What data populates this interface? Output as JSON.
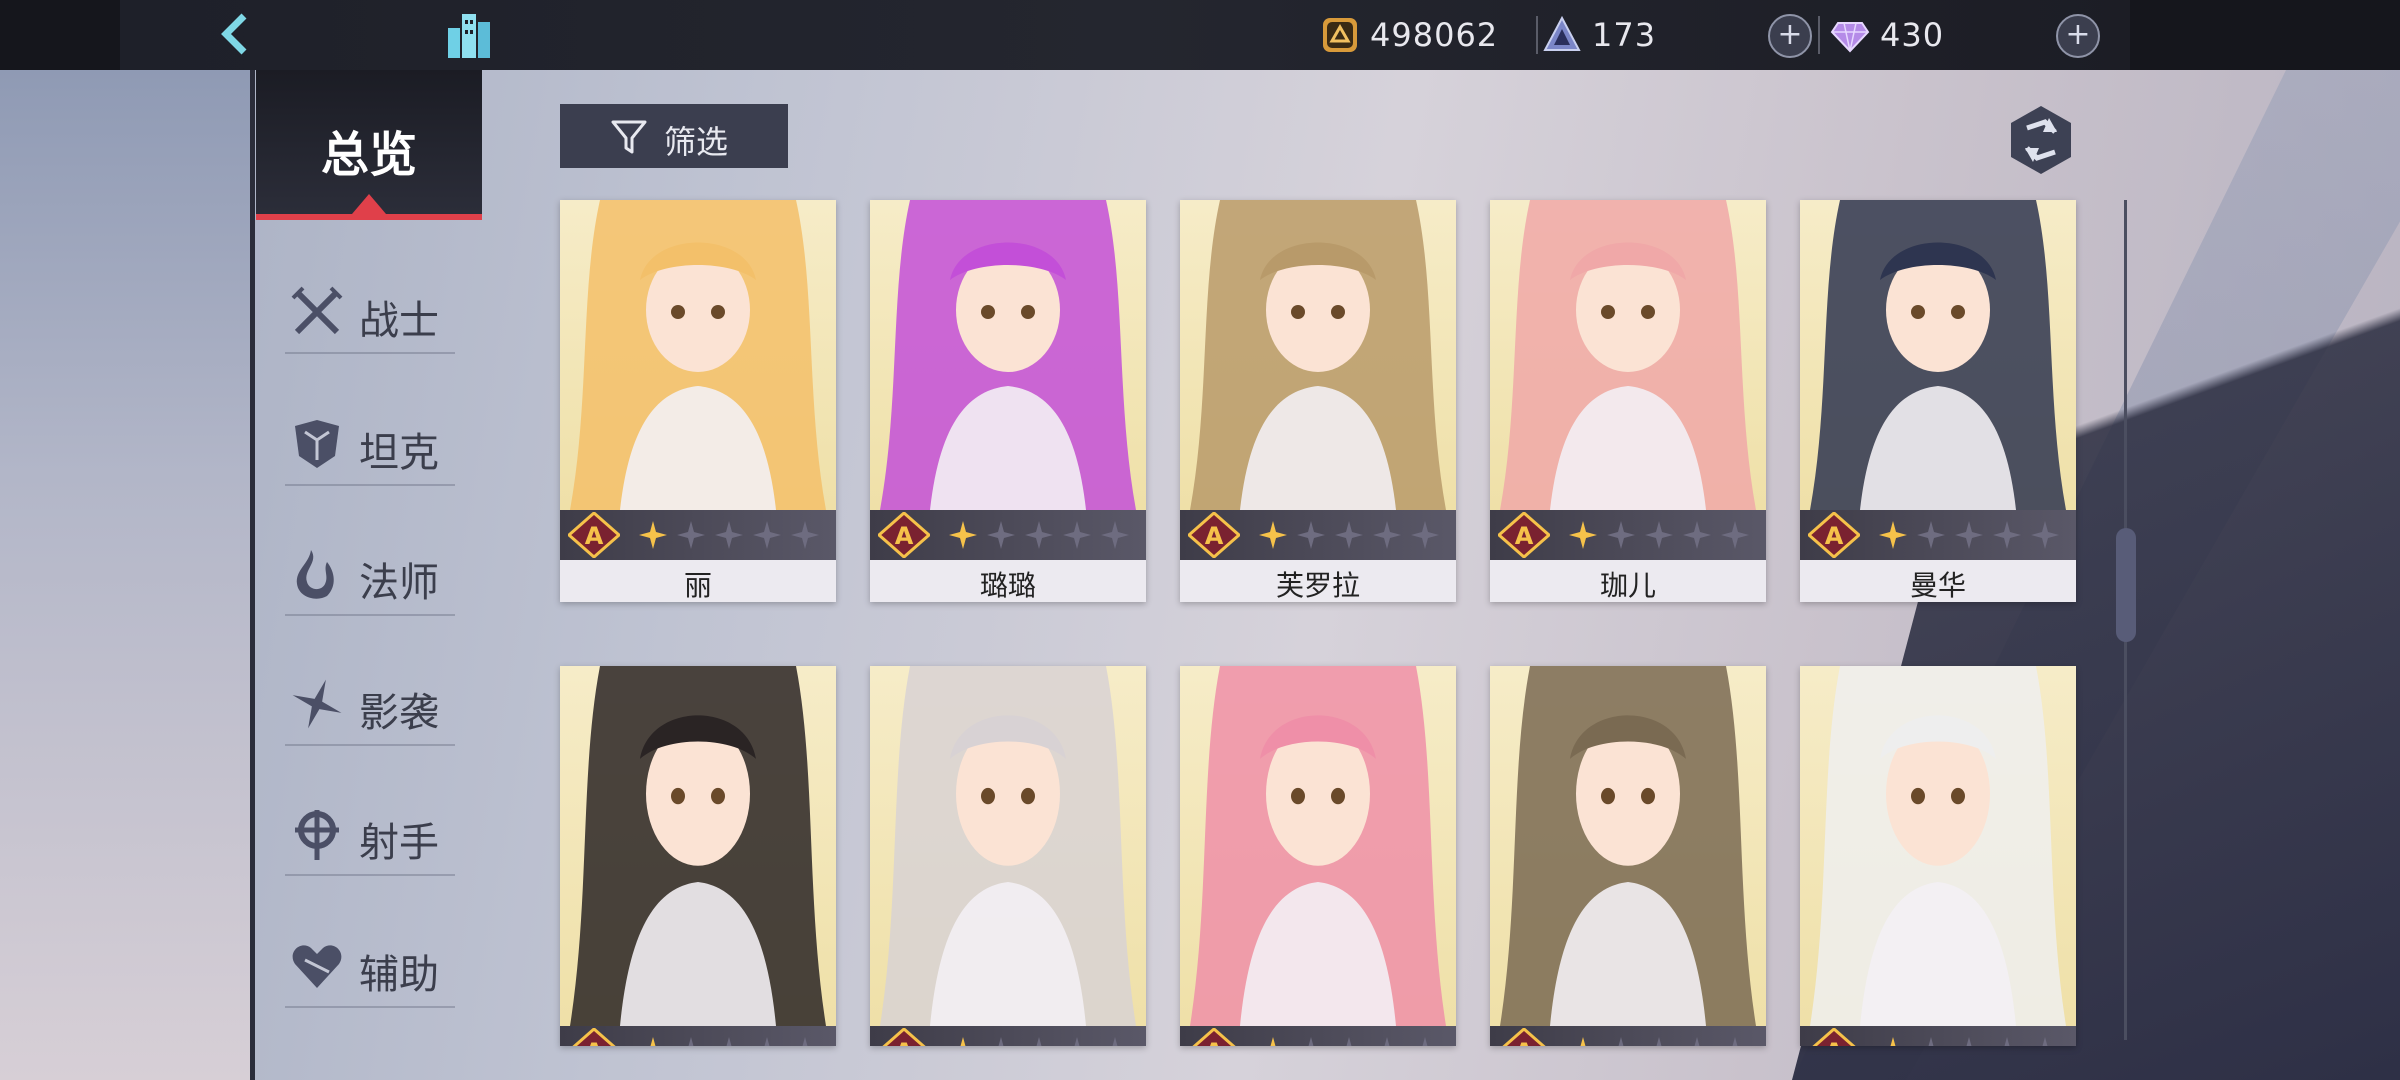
{
  "topbar": {
    "gold": "498062",
    "stamina": "173",
    "gems": "430",
    "plus": "+"
  },
  "sidebar": {
    "overview": "总览",
    "categories": [
      "战士",
      "坦克",
      "法师",
      "影袭",
      "射手",
      "辅助"
    ]
  },
  "toolbar": {
    "filter_label": "筛选"
  },
  "cards": [
    {
      "name": "丽",
      "rank": "A",
      "stars": 1,
      "art": "#f6ecc8",
      "hair": "#f3c06a"
    },
    {
      "name": "璐璐",
      "rank": "A",
      "stars": 1,
      "art": "#f6ecc8",
      "hair": "#c34fd8"
    },
    {
      "name": "芙罗拉",
      "rank": "A",
      "stars": 1,
      "art": "#f6ecc8",
      "hair": "#b89a6a"
    },
    {
      "name": "珈儿",
      "rank": "A",
      "stars": 1,
      "art": "#f6ecc8",
      "hair": "#f0a8a8"
    },
    {
      "name": "曼华",
      "rank": "A",
      "stars": 1,
      "art": "#f6ecc8",
      "hair": "#2e3550"
    },
    {
      "name": "",
      "rank": "A",
      "stars": 1,
      "art": "#f6ecc8",
      "hair": "#2a2424"
    },
    {
      "name": "",
      "rank": "A",
      "stars": 1,
      "art": "#f6ecc8",
      "hair": "#d8d2d4"
    },
    {
      "name": "",
      "rank": "A",
      "stars": 1,
      "art": "#f6ecc8",
      "hair": "#ef8fa8"
    },
    {
      "name": "",
      "rank": "A",
      "stars": 1,
      "art": "#f6ecc8",
      "hair": "#7a6a52"
    },
    {
      "name": "",
      "rank": "A",
      "stars": 1,
      "art": "#f6ecc8",
      "hair": "#eeeeee"
    }
  ],
  "colors": {
    "accent_red": "#e0404a",
    "rank_gold": "#f6c24a"
  }
}
